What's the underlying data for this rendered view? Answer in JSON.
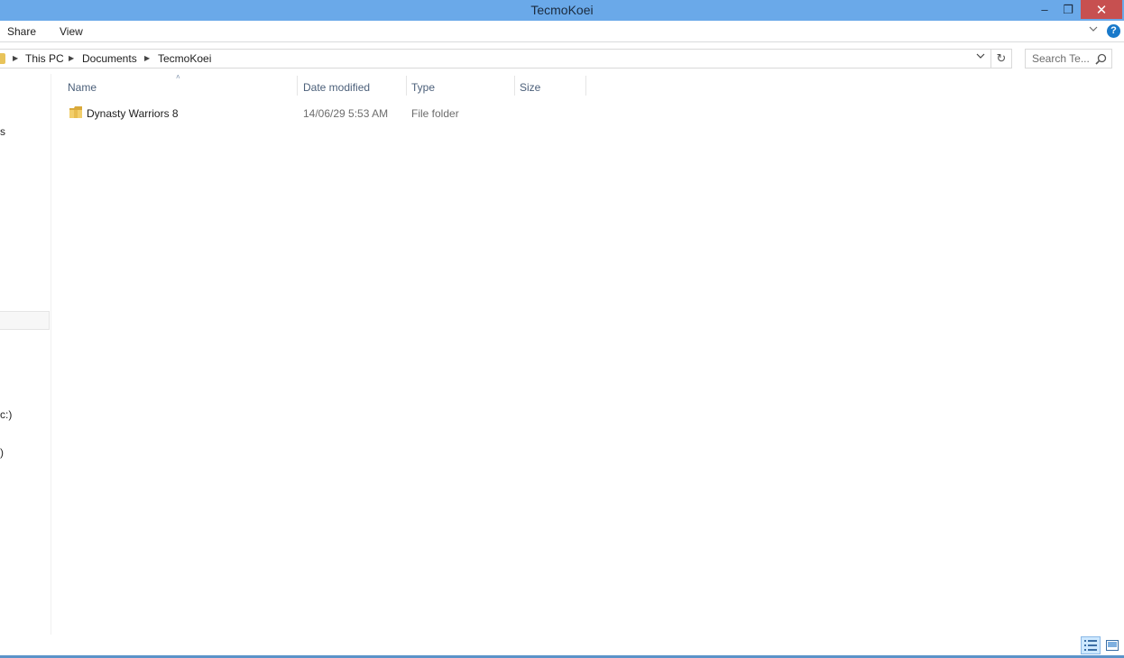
{
  "window": {
    "title": "TecmoKoei",
    "minimize_symbol": "–",
    "maximize_symbol": "❐",
    "close_symbol": "✕"
  },
  "ribbon": {
    "tabs": [
      {
        "label": "Share"
      },
      {
        "label": "View"
      }
    ],
    "expand_icon": "chevron-down-icon",
    "help_label": "?"
  },
  "address": {
    "crumbs": [
      "This PC",
      "Documents",
      "TecmoKoei"
    ],
    "dropdown_symbol": "⌄",
    "refresh_symbol": "↻"
  },
  "search": {
    "placeholder": "Search Te..."
  },
  "nav_pane": {
    "fragments": [
      "s",
      "c:)",
      ")"
    ]
  },
  "columns": {
    "name": "Name",
    "date_modified": "Date modified",
    "type": "Type",
    "size": "Size",
    "sort_indicator": "˄"
  },
  "files": [
    {
      "name": "Dynasty Warriors 8",
      "date_modified": "14/06/29 5:53 AM",
      "type": "File folder",
      "size": ""
    }
  ],
  "colors": {
    "titlebar": "#6aa9e9",
    "close_button": "#c75050",
    "folder": "#e8c35a",
    "header_text": "#4c607a",
    "help": "#1979ca"
  }
}
